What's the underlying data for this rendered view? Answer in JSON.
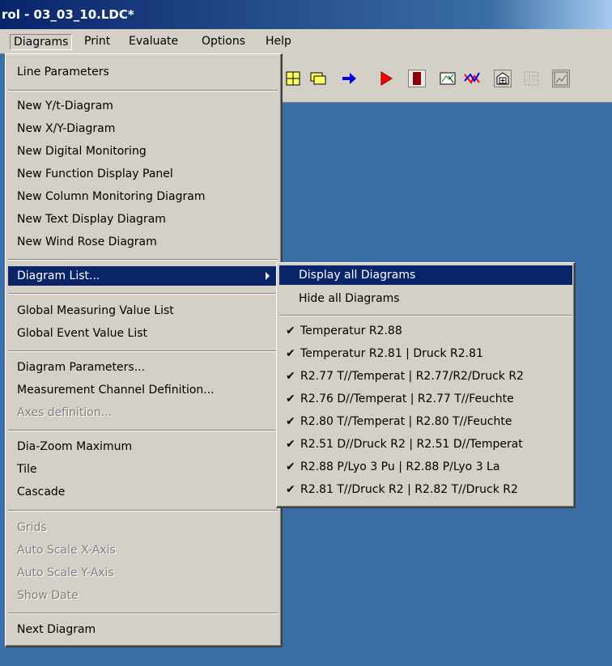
{
  "window": {
    "title": "rol - 03_03_10.LDC*"
  },
  "menubar": {
    "items": [
      "Diagrams",
      "Print",
      "Evaluate",
      "Options",
      "Help"
    ]
  },
  "diagrams_menu": {
    "line_parameters": "Line Parameters",
    "new_yt": "New Y/t-Diagram",
    "new_xy": "New X/Y-Diagram",
    "new_digital": "New Digital Monitoring",
    "new_function": "New Function Display Panel",
    "new_column": "New Column Monitoring Diagram",
    "new_text": "New Text Display Diagram",
    "new_wind": "New Wind Rose Diagram",
    "diagram_list": "Diagram List...",
    "global_measuring": "Global Measuring Value List",
    "global_event": "Global Event Value List",
    "diagram_parameters": "Diagram Parameters...",
    "channel_definition": "Measurement Channel Definition...",
    "axes_definition": "Axes definition...",
    "dia_zoom": "Dia-Zoom Maximum",
    "tile": "Tile",
    "cascade": "Cascade",
    "grids": "Grids",
    "auto_x": "Auto Scale X-Axis",
    "auto_y": "Auto Scale Y-Axis",
    "show_date": "Show Date",
    "next_diagram": "Next Diagram"
  },
  "diagram_list_submenu": {
    "display_all": "Display all Diagrams",
    "hide_all": "Hide all Diagrams",
    "diagrams": [
      "Temperatur R2.88",
      "Temperatur R2.81 | Druck R2.81",
      "R2.77 T//Temperat | R2.77/R2/Druck R2",
      "R2.76 D//Temperat | R2.77 T//Feuchte",
      "R2.80 T//Temperat | R2.80 T//Feuchte",
      "R2.51 D//Druck R2 | R2.51 D//Temperat",
      "R2.88 P/Lyo 3 Pu | R2.88 P/Lyo 3 La",
      "R2.81 T//Druck R2 | R2.82 T//Druck R2"
    ],
    "check_glyph": "✔"
  },
  "toolbar": {
    "icons": [
      "grid-yellow-icon",
      "folders-icon",
      "arrow-right-icon",
      "play-icon",
      "stop-icon",
      "cursor-diagram-icon",
      "multi-line-icon",
      "add-panel-icon",
      "dotted-grid-icon",
      "chart-icon"
    ]
  }
}
